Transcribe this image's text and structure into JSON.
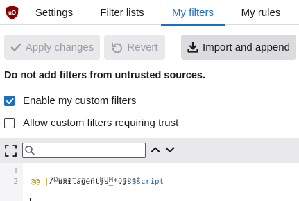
{
  "tabs": [
    {
      "label": "Settings",
      "active": false
    },
    {
      "label": "Filter lists",
      "active": false
    },
    {
      "label": "My filters",
      "active": true
    },
    {
      "label": "My rules",
      "active": false
    }
  ],
  "toolbar": {
    "apply_label": "Apply changes",
    "revert_label": "Revert",
    "import_label": "Import and append"
  },
  "warning": "Do not add filters from untrusted sources.",
  "options": {
    "enable_label": "Enable my custom filters",
    "enable_checked": true,
    "trust_label": "Allow custom filters requiring trust",
    "trust_checked": false
  },
  "search": {
    "value": "",
    "placeholder": ""
  },
  "editor": {
    "lines": [
      {
        "number": "1",
        "comment": "!Dynatrace RUM agent"
      },
      {
        "number": "2",
        "op": "@@||",
        "plain": "/ruxitagentjs_*.js",
        "option": "$script"
      }
    ]
  },
  "colors": {
    "accent": "#1a6fc4",
    "logo_red": "#8b0000",
    "comment": "#7a7a7a",
    "operator": "#b59a00",
    "option": "#1a64c8"
  },
  "icons": [
    "ublock-logo-icon",
    "checkmark-icon",
    "revert-icon",
    "import-icon",
    "expand-icon",
    "search-icon",
    "chevron-up-icon",
    "chevron-down-icon"
  ]
}
